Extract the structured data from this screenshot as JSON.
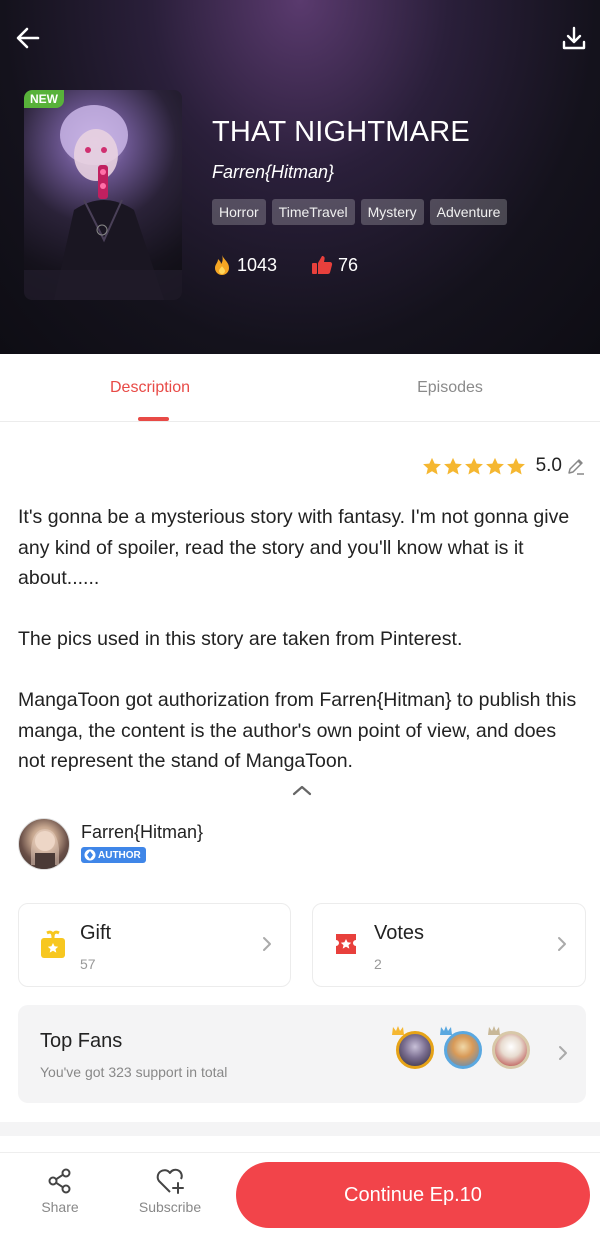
{
  "header": {
    "new_badge": "NEW",
    "title": "THAT NIGHTMARE",
    "author": "Farren{Hitman}",
    "tags": [
      "Horror",
      "TimeTravel",
      "Mystery",
      "Adventure"
    ],
    "views": "1043",
    "likes": "76"
  },
  "tabs": [
    {
      "label": "Description",
      "active": true
    },
    {
      "label": "Episodes",
      "active": false
    }
  ],
  "rating": {
    "value": "5.0",
    "stars": 5
  },
  "description": {
    "paragraphs": [
      "It's gonna be a mysterious story with fantasy. I'm not gonna give any kind of spoiler, read the story and you'll know what is it about......",
      "The pics used in this story are taken from Pinterest.",
      "MangaToon got authorization from Farren{Hitman} to publish this manga, the content is the author's own point of view, and does not represent the stand of MangaToon."
    ]
  },
  "author": {
    "name": "Farren{Hitman}",
    "badge": "AUTHOR"
  },
  "gift": {
    "title": "Gift",
    "count": "57"
  },
  "votes": {
    "title": "Votes",
    "count": "2"
  },
  "fans": {
    "title": "Top Fans",
    "subtitle": "You've got 323 support in total"
  },
  "bottom_bar": {
    "share_label": "Share",
    "subscribe_label": "Subscribe",
    "continue_label": "Continue Ep.10"
  },
  "colors": {
    "accent": "#e84a46",
    "button": "#f2444a",
    "star": "#f5b731"
  }
}
